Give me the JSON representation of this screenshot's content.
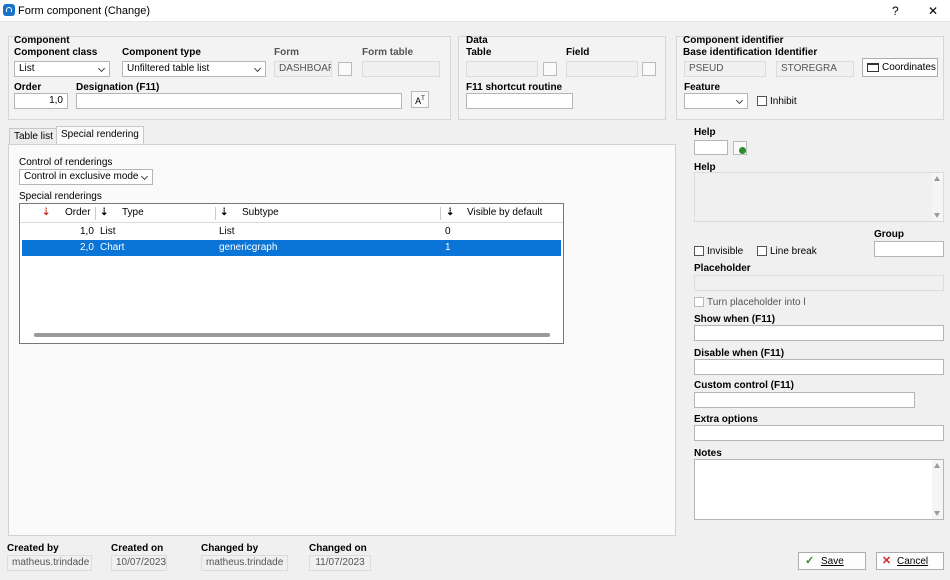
{
  "window": {
    "title": "Form component (Change)",
    "help_glyph": "?",
    "close_glyph": "✕"
  },
  "component": {
    "group_label": "Component",
    "class_label": "Component class",
    "class_value": "List",
    "type_label": "Component type",
    "type_value": "Unfiltered table list",
    "form_label": "Form",
    "form_value": "DASHBOAR",
    "formtable_label": "Form table",
    "formtable_value": "",
    "order_label": "Order",
    "order_value": "1,0",
    "designation_label": "Designation (F11)",
    "designation_value": ""
  },
  "data_group": {
    "group_label": "Data",
    "table_label": "Table",
    "table_value": "",
    "field_label": "Field",
    "field_value": "",
    "f11_label": "F11 shortcut routine",
    "f11_value": ""
  },
  "identifier": {
    "group_label": "Component identifier",
    "base_label": "Base identification",
    "base_value": "PSEUD",
    "id_label": "Identifier",
    "id_value": "STOREGRA",
    "coordinates_label": "Coordinates",
    "feature_label": "Feature",
    "feature_value": "",
    "inhibit_label": "Inhibit"
  },
  "tabs": [
    {
      "label": "Table list"
    },
    {
      "label": "Special rendering"
    }
  ],
  "rendering": {
    "control_label": "Control of renderings",
    "control_value": "Control in exclusive mode",
    "special_label": "Special renderings",
    "columns": [
      "Order",
      "Type",
      "Subtype",
      "Visible by default"
    ],
    "rows": [
      {
        "order": "1,0",
        "type": "List",
        "subtype": "List",
        "visible": "0"
      },
      {
        "order": "2,0",
        "type": "Chart",
        "subtype": "genericgraph",
        "visible": "1"
      }
    ],
    "selected_row": 1
  },
  "right": {
    "help_label": "Help",
    "help_value": "",
    "help2_label": "Help",
    "help2_value": "",
    "invisible_label": "Invisible",
    "linebreak_label": "Line break",
    "group_label": "Group",
    "group_value": "",
    "placeholder_label": "Placeholder",
    "placeholder_value": "",
    "turn_placeholder_label": "Turn placeholder into l",
    "show_when_label": "Show when (F11)",
    "show_when_value": "",
    "disable_when_label": "Disable when (F11)",
    "disable_when_value": "",
    "custom_control_label": "Custom control (F11)",
    "custom_control_value": "",
    "extra_options_label": "Extra options",
    "extra_options_value": "",
    "notes_label": "Notes",
    "notes_value": ""
  },
  "footer": {
    "created_by_label": "Created by",
    "created_by_value": "matheus.trindade",
    "created_on_label": "Created on",
    "created_on_value": "10/07/2023",
    "changed_by_label": "Changed by",
    "changed_by_value": "matheus.trindade",
    "changed_on_label": "Changed on",
    "changed_on_value": "11/07/2023",
    "save_label": "Save",
    "cancel_label": "Cancel",
    "save_glyph": "✓",
    "cancel_glyph": "✕"
  },
  "colors": {
    "selection": "#0a74d7",
    "accent": "#1a73c8",
    "cancel_red": "#d02020",
    "save_green": "#2e8b2e"
  }
}
